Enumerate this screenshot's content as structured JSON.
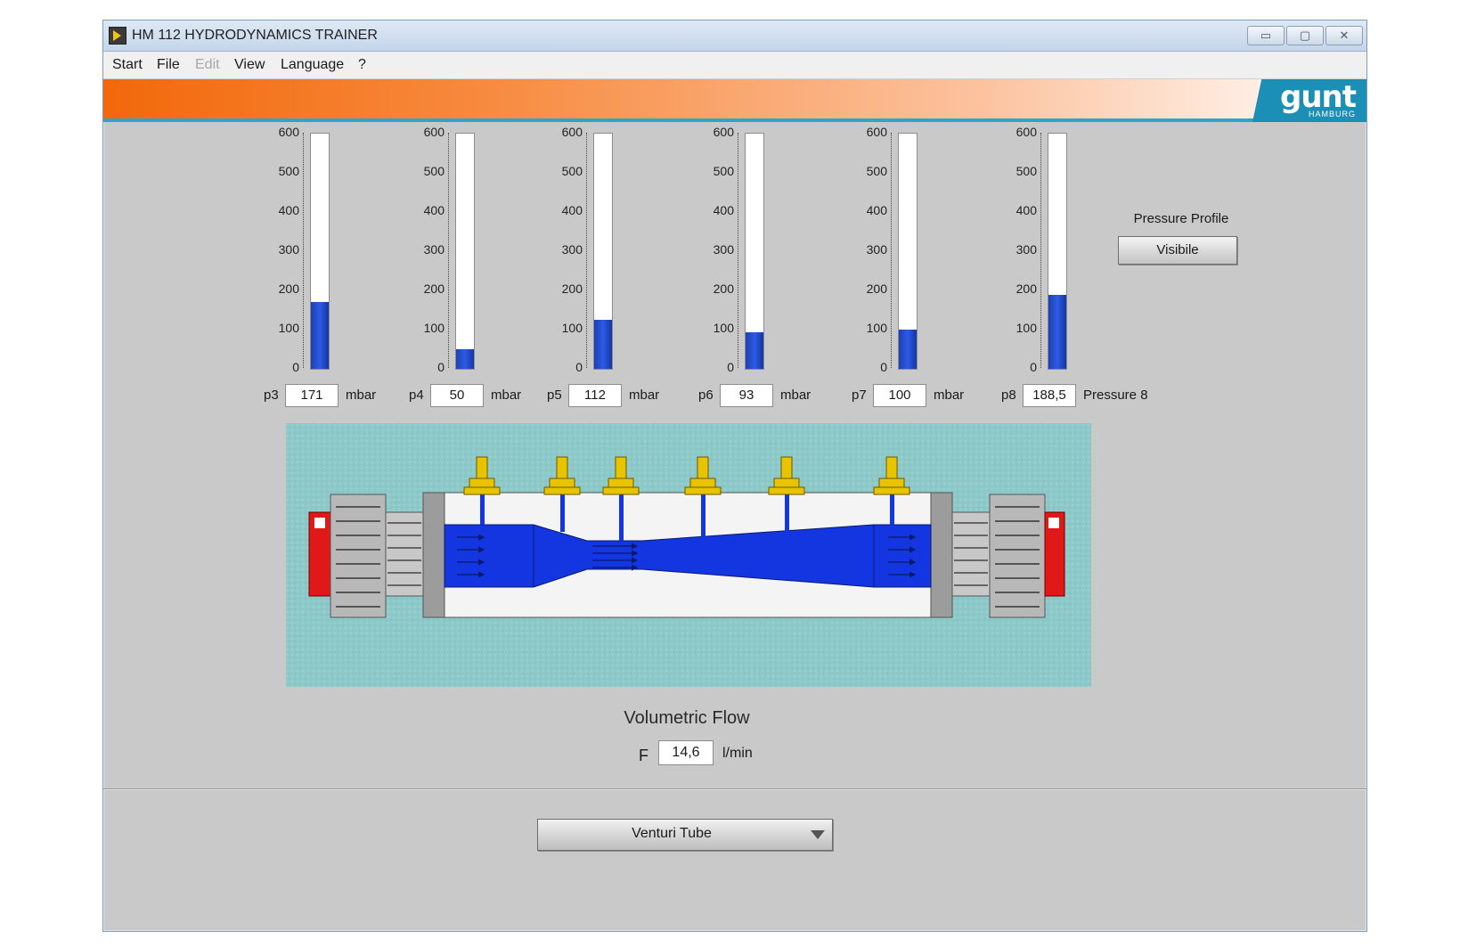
{
  "window": {
    "title": "HM 112 HYDRODYNAMICS TRAINER",
    "controls": {
      "minimize": "▭",
      "maximize": "▢",
      "close": "✕"
    }
  },
  "menu": [
    "Start",
    "File",
    "Edit",
    "View",
    "Language",
    "?"
  ],
  "logo": {
    "text": "gunt",
    "subtext": "HAMBURG"
  },
  "scale": {
    "max": 600,
    "ticks": [
      "600",
      "500",
      "400",
      "300",
      "200",
      "100",
      "0"
    ]
  },
  "gauges": [
    {
      "name": "p3",
      "value": "171",
      "unit": "mbar",
      "level": 171
    },
    {
      "name": "p4",
      "value": "50",
      "unit": "mbar",
      "level": 50
    },
    {
      "name": "p5",
      "value": "112",
      "unit": "mbar",
      "level": 125
    },
    {
      "name": "p6",
      "value": "93",
      "unit": "mbar",
      "level": 93
    },
    {
      "name": "p7",
      "value": "100",
      "unit": "mbar",
      "level": 100
    },
    {
      "name": "p8",
      "value": "188,5",
      "unit": "Pressure 8",
      "level": 188.5
    }
  ],
  "pressure_profile": {
    "label": "Pressure Profile",
    "button": "Visibile"
  },
  "flow": {
    "title": "Volumetric Flow",
    "symbol": "F",
    "value": "14,6",
    "unit": "l/min"
  },
  "selector": {
    "selected": "Venturi Tube"
  },
  "colors": {
    "banner_orange": "#f2680a",
    "fill_blue": "#2b5be6",
    "diagram_bg": "#8ec9c9",
    "logo_blue": "#1c8fb6",
    "fitting_yellow": "#e8c400"
  }
}
